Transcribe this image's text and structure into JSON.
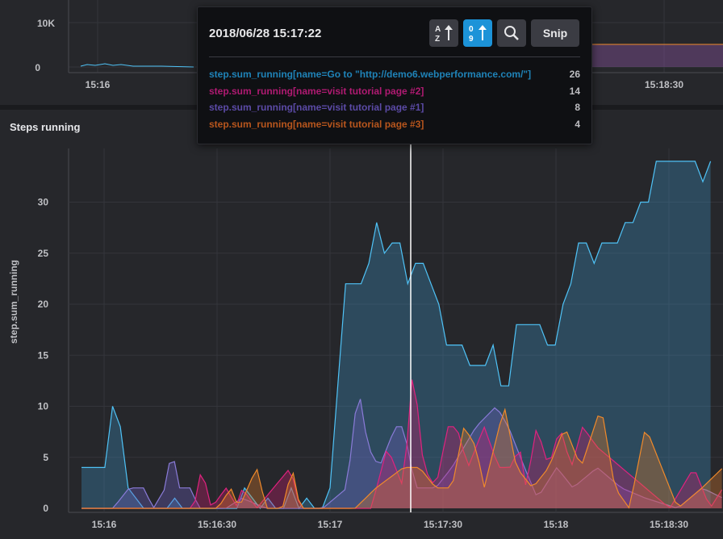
{
  "top_panel": {
    "y_ticks": [
      "10K",
      "0"
    ],
    "x_ticks": [
      "15:16",
      "15:18:30"
    ]
  },
  "main_panel": {
    "title": "Steps running",
    "y_axis_label": "step.sum_running"
  },
  "tooltip": {
    "timestamp": "2018/06/28 15:17:22",
    "sort_az_label": "A Z",
    "sort_09_label": "0 9",
    "snip_label": "Snip",
    "rows": [
      {
        "label": "step.sum_running[name=Go to \"http://demo6.webperformance.com/\"]",
        "value": "26",
        "color": "#1f83b8"
      },
      {
        "label": "step.sum_running[name=visit tutorial page #2]",
        "value": "14",
        "color": "#b01a72"
      },
      {
        "label": "step.sum_running[name=visit tutorial page #1]",
        "value": "8",
        "color": "#5b4aa6"
      },
      {
        "label": "step.sum_running[name=visit tutorial page #3]",
        "value": "4",
        "color": "#b8561d"
      }
    ]
  },
  "chart_data": {
    "type": "area",
    "title": "Steps running",
    "ylabel": "step.sum_running",
    "ylim": [
      0,
      35
    ],
    "y_ticks": [
      0,
      5,
      10,
      15,
      20,
      25,
      30
    ],
    "x_ticks": [
      "15:16",
      "15:16:30",
      "15:17",
      "15:17:30",
      "15:18",
      "15:18:30"
    ],
    "x_range_seconds": [
      -7,
      74
    ],
    "cursor_x_seconds": 22,
    "series": [
      {
        "name": "step.sum_running[name=Go to \"http://demo6.webperformance.com/\"]",
        "color": "#4fc3f7",
        "fill": "rgba(60,140,185,0.35)",
        "x": [
          -7,
          -4,
          -3,
          -2,
          -1,
          0,
          1,
          2,
          3,
          4,
          5,
          6,
          7,
          8,
          9,
          10,
          11,
          12,
          13,
          14,
          15,
          16,
          17,
          18,
          19,
          20,
          21,
          22,
          23,
          24,
          25,
          26,
          27,
          28,
          29,
          30,
          31,
          32,
          33,
          34,
          35,
          36,
          37,
          38,
          39,
          40,
          41,
          42,
          43,
          44,
          45,
          46,
          47,
          48,
          49,
          50,
          51,
          52,
          53,
          54,
          55,
          56,
          57,
          58,
          59,
          60,
          61,
          62,
          63,
          64,
          65,
          66,
          67,
          68,
          69,
          70,
          71,
          72,
          73,
          74
        ],
        "y": [
          4,
          4,
          10,
          8,
          2,
          1,
          0,
          0,
          0,
          0,
          1,
          0,
          0,
          0,
          0,
          0,
          0,
          0,
          0,
          2,
          1,
          0,
          1,
          0,
          0,
          2,
          0,
          1,
          0,
          0,
          2,
          12,
          22,
          22,
          22,
          24,
          28,
          25,
          26,
          26,
          22,
          24,
          24,
          22,
          20,
          16,
          16,
          16,
          14,
          14,
          14,
          16,
          12,
          12,
          18,
          18,
          18,
          18,
          16,
          16,
          20,
          22,
          26,
          26,
          24,
          26,
          26,
          26,
          28,
          28,
          30,
          30,
          34,
          34,
          34,
          34,
          34,
          34,
          32,
          34
        ]
      },
      {
        "name": "step.sum_running[name=visit tutorial page #1]",
        "color": "#8a7bd8",
        "fill": "rgba(110,95,190,0.35)"
      },
      {
        "name": "step.sum_running[name=visit tutorial page #2]",
        "color": "#e0237f",
        "fill": "rgba(200,30,110,0.35)"
      },
      {
        "name": "step.sum_running[name=visit tutorial page #3]",
        "color": "#f08a2b",
        "fill": "rgba(220,120,40,0.35)"
      }
    ]
  }
}
